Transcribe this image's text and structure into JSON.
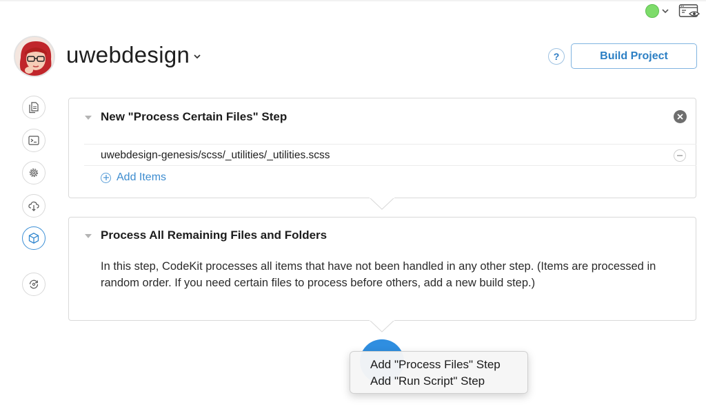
{
  "header": {
    "project_name": "uwebdesign",
    "help_label": "?",
    "build_button": "Build Project"
  },
  "colors": {
    "accent": "#2b7fc4",
    "status_green": "#7ddc6a",
    "fab_blue": "#2f8ee0"
  },
  "sidebar": {
    "items": [
      {
        "icon": "files-icon"
      },
      {
        "icon": "terminal-icon"
      },
      {
        "icon": "gear-icon"
      },
      {
        "icon": "cloud-download-icon"
      },
      {
        "icon": "package-icon",
        "active": true
      },
      {
        "icon": "sync-icon"
      }
    ]
  },
  "steps": [
    {
      "title": "New \"Process Certain Files\" Step",
      "files": [
        "uwebdesign-genesis/scss/_utilities/_utilities.scss"
      ],
      "add_items_label": "Add Items"
    },
    {
      "title": "Process All Remaining Files and Folders",
      "description": "In this step, CodeKit processes all items that have not been handled in any other step. (Items are processed in random order. If you need certain files to process before others, add a new build step.)"
    }
  ],
  "add_menu": {
    "items": [
      "Add \"Process Files\" Step",
      "Add \"Run Script\" Step"
    ]
  }
}
